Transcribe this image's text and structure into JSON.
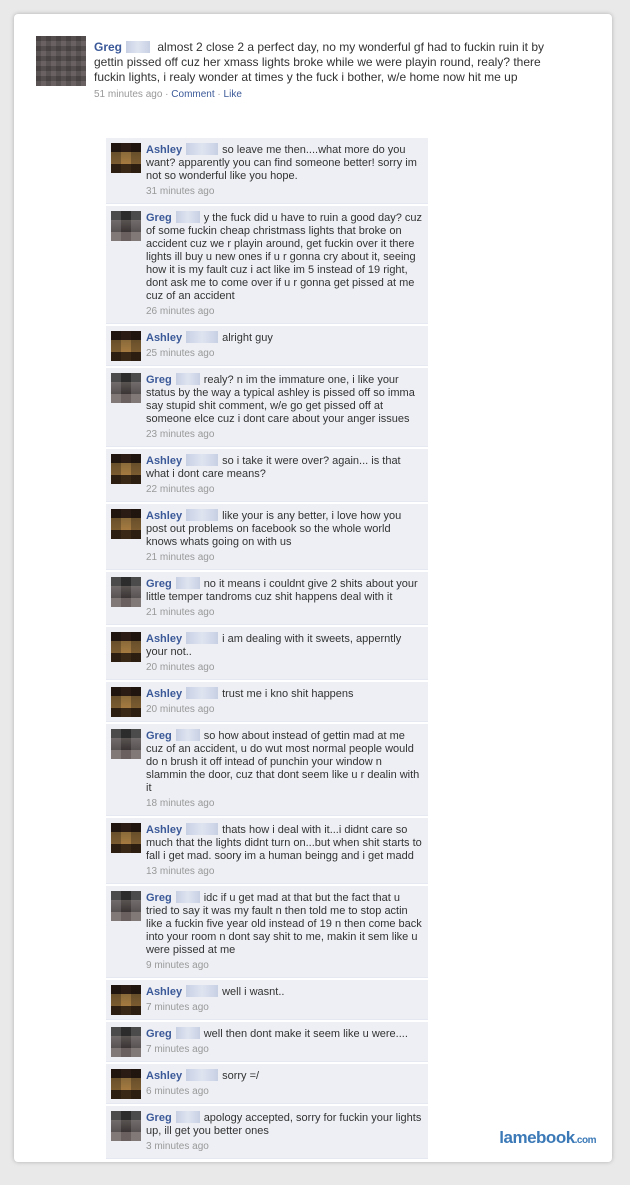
{
  "status": {
    "author": "Greg",
    "text": "almost 2 close 2 a perfect day, no my wonderful gf had to fuckin ruin it by gettin pissed off cuz her xmass lights broke while we were playin round, realy? there fuckin lights, i realy wonder at times y the fuck i bother, w/e home now hit me up",
    "time": "51 minutes ago",
    "sep1": " · ",
    "comment_link": "Comment",
    "sep2": " · ",
    "like_link": "Like"
  },
  "comments": [
    {
      "author": "Ashley",
      "kind": "ashley",
      "text": "so leave me then....what more do you want? apparently you can find someone better! sorry im not so wonderful like you hope.",
      "time": "31 minutes ago"
    },
    {
      "author": "Greg",
      "kind": "greg",
      "text": "y the fuck did u have to ruin a good day? cuz of some fuckin cheap christmass lights that broke on accident cuz we r playin around, get fuckin over it there lights ill buy u new ones if u r gonna cry about it, seeing how it is my fault cuz i act like im 5 instead of 19 right, dont ask me to come over if u r gonna get pissed at me cuz of an accident",
      "time": "26 minutes ago"
    },
    {
      "author": "Ashley",
      "kind": "ashley",
      "text": "alright guy",
      "time": "25 minutes ago"
    },
    {
      "author": "Greg",
      "kind": "greg",
      "text": "realy? n im the immature one, i like your status by the way a typical ashley is pissed off so imma say stupid shit comment, w/e go get pissed off at someone elce cuz i dont care about your anger issues",
      "time": "23 minutes ago"
    },
    {
      "author": "Ashley",
      "kind": "ashley",
      "text": "so i take it were over? again... is that what i dont care means?",
      "time": "22 minutes ago"
    },
    {
      "author": "Ashley",
      "kind": "ashley",
      "text": "like your is any better, i love how you post out problems on facebook so the whole world knows whats going on with us",
      "time": "21 minutes ago"
    },
    {
      "author": "Greg",
      "kind": "greg",
      "text": "no it means i couldnt give 2 shits about your little temper tandroms cuz shit happens deal with it",
      "time": "21 minutes ago"
    },
    {
      "author": "Ashley",
      "kind": "ashley",
      "text": "i am dealing with it sweets, apperntly your not..",
      "time": "20 minutes ago"
    },
    {
      "author": "Ashley",
      "kind": "ashley",
      "text": "trust me i kno shit happens",
      "time": "20 minutes ago"
    },
    {
      "author": "Greg",
      "kind": "greg",
      "text": "so how about instead of gettin mad at me cuz of an accident, u do wut most normal people would do n brush it off intead of punchin your window n slammin the door, cuz that dont seem like u r dealin with it",
      "time": "18 minutes ago"
    },
    {
      "author": "Ashley",
      "kind": "ashley",
      "text": "thats how i deal with it...i didnt care so much that the lights didnt turn on...but when shit starts to fall i get mad. soory im a human beingg and i get madd",
      "time": "13 minutes ago"
    },
    {
      "author": "Greg",
      "kind": "greg",
      "text": "idc if u get mad at that but the fact that u tried to say it was my fault n then told me to stop actin like a fuckin five year old instead of 19 n then come back into your room n dont say shit to me, makin it sem like u were pissed at me",
      "time": "9 minutes ago"
    },
    {
      "author": "Ashley",
      "kind": "ashley",
      "text": "well i wasnt..",
      "time": "7 minutes ago"
    },
    {
      "author": "Greg",
      "kind": "greg",
      "text": "well then dont make it seem like u were....",
      "time": "7 minutes ago"
    },
    {
      "author": "Ashley",
      "kind": "ashley",
      "text": "sorry =/",
      "time": "6 minutes ago"
    },
    {
      "author": "Greg",
      "kind": "greg",
      "text": "apology accepted, sorry for fuckin your lights up, ill get you better ones",
      "time": "3 minutes ago"
    }
  ],
  "brand": {
    "name": "lamebook",
    "suffix": ".com"
  }
}
